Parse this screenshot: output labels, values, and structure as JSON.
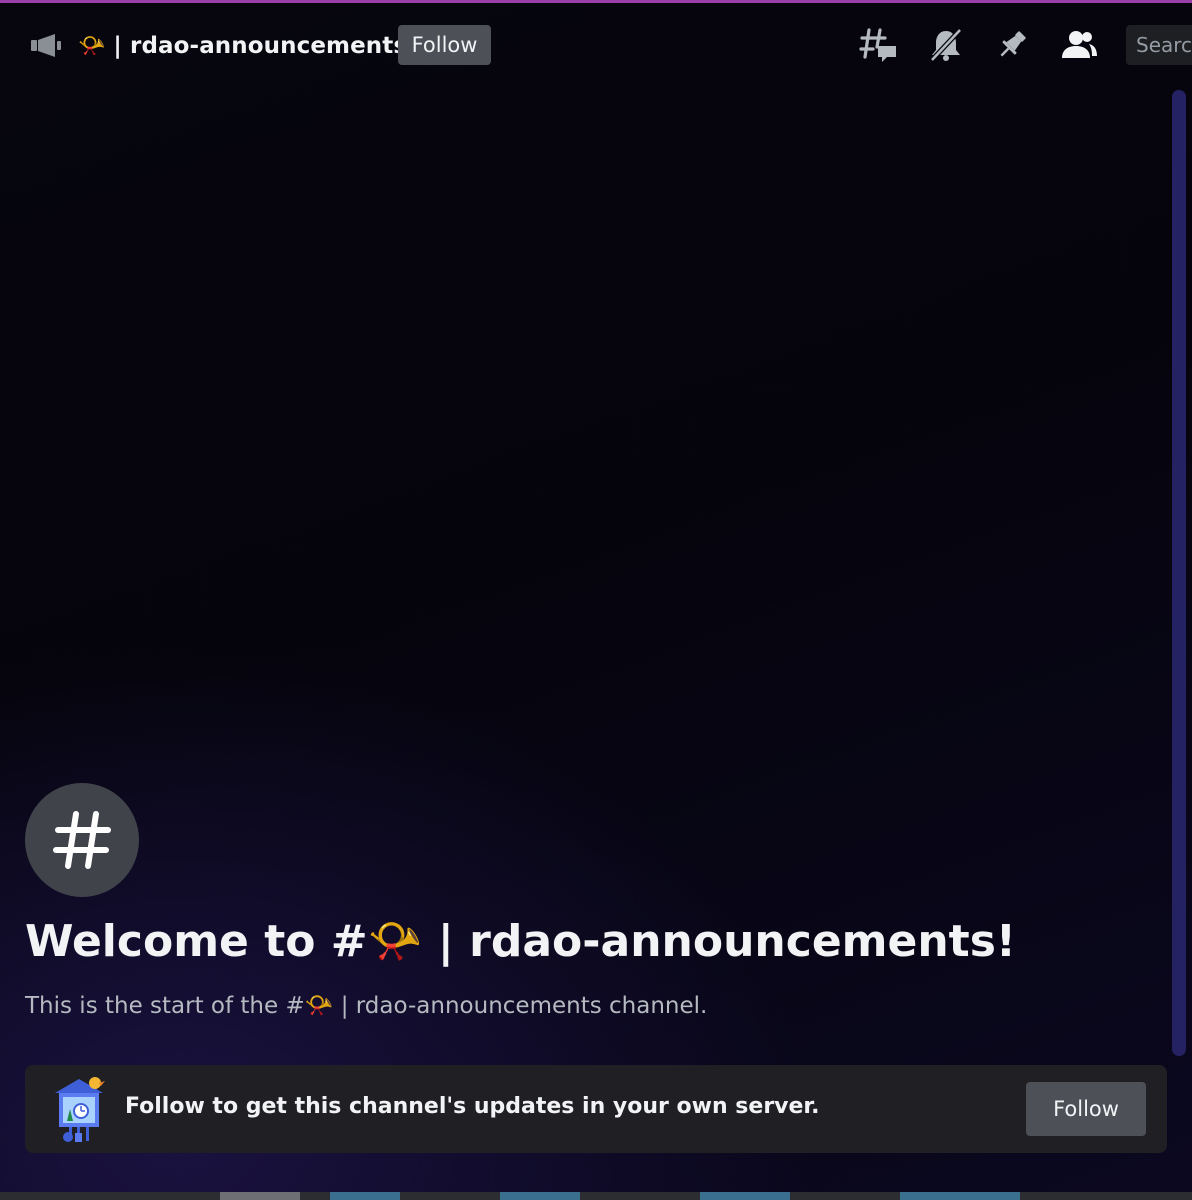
{
  "header": {
    "channel_emoji": "📯",
    "channel_name": "| rdao-announcements",
    "follow_label": "Follow",
    "search_placeholder": "Search"
  },
  "welcome": {
    "title": "Welcome to #📯 | rdao-announcements!",
    "subtitle": "This is the start of the #📯 | rdao-announcements channel."
  },
  "follow_card": {
    "text": "Follow to get this channel's updates in your own server.",
    "button_label": "Follow"
  },
  "colors": {
    "accent_top_line": "#9b3fa8",
    "button_bg": "#4e5058",
    "card_bg": "#202024"
  }
}
